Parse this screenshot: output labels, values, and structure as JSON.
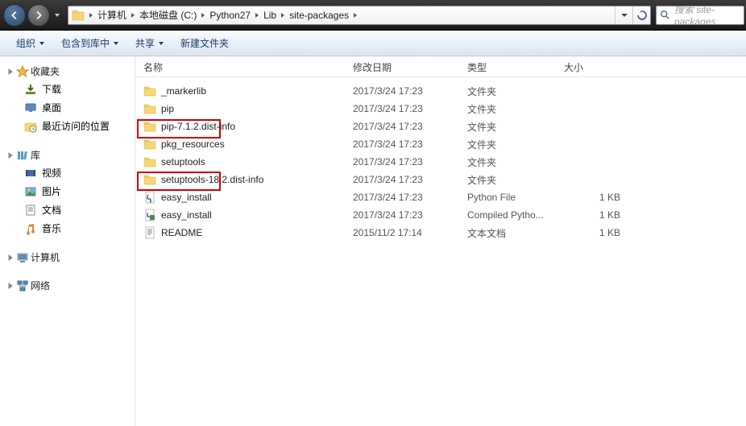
{
  "breadcrumbs": [
    "计算机",
    "本地磁盘 (C:)",
    "Python27",
    "Lib",
    "site-packages"
  ],
  "search": {
    "placeholder": "搜索 site-packages"
  },
  "toolbar": {
    "organize": "组织",
    "include": "包含到库中",
    "share": "共享",
    "newfolder": "新建文件夹"
  },
  "columns": {
    "name": "名称",
    "date": "修改日期",
    "type": "类型",
    "size": "大小"
  },
  "sidebar": {
    "favorites": {
      "label": "收藏夹",
      "items": [
        {
          "label": "下载"
        },
        {
          "label": "桌面"
        },
        {
          "label": "最近访问的位置"
        }
      ]
    },
    "libraries": {
      "label": "库",
      "items": [
        {
          "label": "视频"
        },
        {
          "label": "图片"
        },
        {
          "label": "文档"
        },
        {
          "label": "音乐"
        }
      ]
    },
    "computer": {
      "label": "计算机"
    },
    "network": {
      "label": "网络"
    }
  },
  "files": [
    {
      "icon": "folder",
      "name": "_markerlib",
      "date": "2017/3/24 17:23",
      "type": "文件夹",
      "size": ""
    },
    {
      "icon": "folder",
      "name": "pip",
      "date": "2017/3/24 17:23",
      "type": "文件夹",
      "size": ""
    },
    {
      "icon": "folder",
      "name": "pip-7.1.2.dist-info",
      "date": "2017/3/24 17:23",
      "type": "文件夹",
      "size": ""
    },
    {
      "icon": "folder",
      "name": "pkg_resources",
      "date": "2017/3/24 17:23",
      "type": "文件夹",
      "size": ""
    },
    {
      "icon": "folder",
      "name": "setuptools",
      "date": "2017/3/24 17:23",
      "type": "文件夹",
      "size": ""
    },
    {
      "icon": "folder",
      "name": "setuptools-18.2.dist-info",
      "date": "2017/3/24 17:23",
      "type": "文件夹",
      "size": ""
    },
    {
      "icon": "py",
      "name": "easy_install",
      "date": "2017/3/24 17:23",
      "type": "Python File",
      "size": "1 KB"
    },
    {
      "icon": "pyc",
      "name": "easy_install",
      "date": "2017/3/24 17:23",
      "type": "Compiled Pytho...",
      "size": "1 KB"
    },
    {
      "icon": "txt",
      "name": "README",
      "date": "2015/11/2 17:14",
      "type": "文本文档",
      "size": "1 KB"
    }
  ]
}
